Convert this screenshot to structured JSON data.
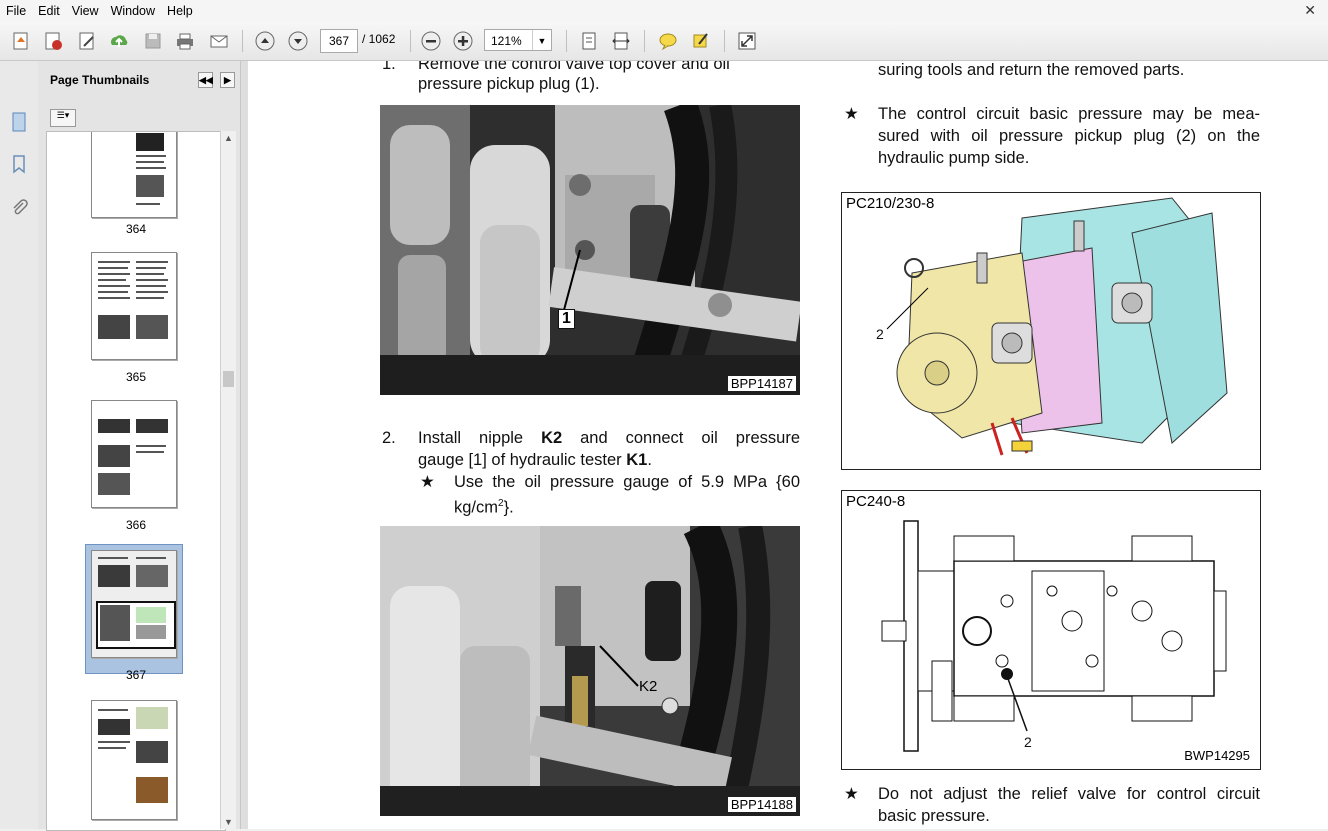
{
  "menu": [
    "File",
    "Edit",
    "View",
    "Window",
    "Help"
  ],
  "toolbar": {
    "current_page": "367",
    "total_pages": "/ 1062",
    "zoom": "121%",
    "icons": [
      "create-pdf-icon",
      "export-icon",
      "edit-icon",
      "upload-icon",
      "save-icon",
      "print-icon",
      "email-icon",
      "page-up-icon",
      "page-down-icon",
      "zoom-out-icon",
      "zoom-in-icon",
      "fit-page-icon",
      "fit-width-icon",
      "comment-icon",
      "highlight-icon",
      "fullscreen-icon"
    ]
  },
  "sidebar": {
    "title": "Page Thumbnails",
    "thumbnails": [
      {
        "label": "364"
      },
      {
        "label": "365"
      },
      {
        "label": "366"
      },
      {
        "label": "367"
      },
      {
        "label": ""
      }
    ]
  },
  "document": {
    "step1_num": "1.",
    "step1_line1": "Remove the control valve top cover and oil",
    "step1_line2": "pressure pickup plug (1).",
    "photo1_callout": "1",
    "photo1_code": "BPP14187",
    "step2_num": "2.",
    "step2_l1_a": "Install nipple ",
    "step2_l1_b": "K2",
    "step2_l1_c": " and connect oil pressure",
    "step2_l2_a": "gauge [1] of hydraulic tester ",
    "step2_l2_b": "K1",
    "step2_l2_c": ".",
    "star": "★",
    "step2_note_l1": "Use the oil pressure gauge of 5.9 MPa {60",
    "step2_note_l2_a": "kg/cm",
    "step2_note_l2_sup": "2",
    "step2_note_l2_b": "}.",
    "photo2_callout": "K2",
    "photo2_code": "BPP14188",
    "right_top_line": "suring tools and return the removed parts.",
    "note1_l1": "The control circuit basic pressure may be mea-",
    "note1_l2": "sured with oil pressure pickup plug (2) on the",
    "note1_l3": "hydraulic pump side.",
    "fig1_title": "PC210/230-8",
    "fig1_callout": "2",
    "fig2_title": "PC240-8",
    "fig2_callout": "2",
    "fig2_code": "BWP14295",
    "note2_l1": "Do not adjust the relief valve for control circuit",
    "note2_l2": "basic pressure."
  },
  "colors": {
    "pump_yellow": "#efe6a8",
    "pump_pink": "#ecc2ea",
    "pump_cyan": "#a9e4e4"
  }
}
